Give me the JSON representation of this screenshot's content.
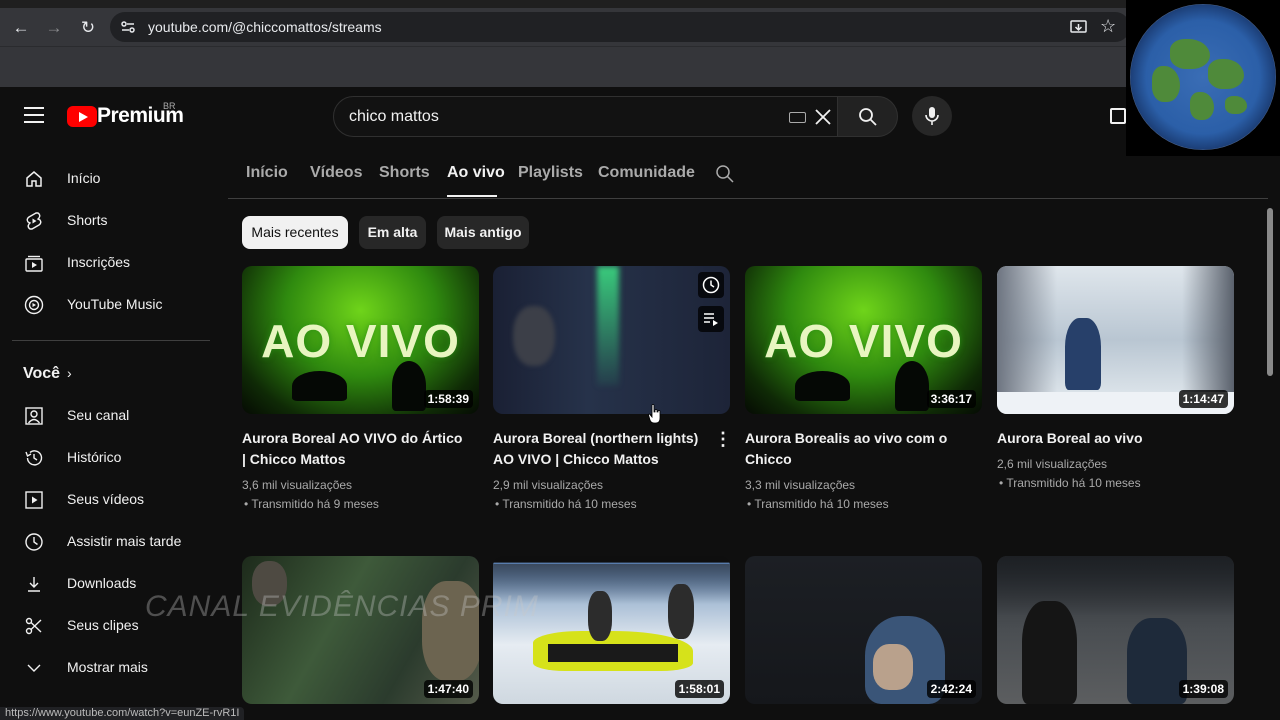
{
  "browser": {
    "url": "youtube.com/@chiccomattos/streams",
    "status_url": "https://www.youtube.com/watch?v=eunZE-rvR1I"
  },
  "masthead": {
    "logo_text": "Premium",
    "region": "BR",
    "search_value": "chico mattos"
  },
  "sidebar": {
    "main": [
      {
        "label": "Início",
        "icon": "home-icon"
      },
      {
        "label": "Shorts",
        "icon": "shorts-icon"
      },
      {
        "label": "Inscrições",
        "icon": "subscriptions-icon"
      },
      {
        "label": "YouTube Music",
        "icon": "youtube-music-icon"
      }
    ],
    "you_heading": "Você",
    "you": [
      {
        "label": "Seu canal",
        "icon": "channel-icon"
      },
      {
        "label": "Histórico",
        "icon": "history-icon"
      },
      {
        "label": "Seus vídeos",
        "icon": "your-videos-icon"
      },
      {
        "label": "Assistir mais tarde",
        "icon": "watch-later-icon"
      },
      {
        "label": "Downloads",
        "icon": "download-icon"
      },
      {
        "label": "Seus clipes",
        "icon": "clips-icon"
      },
      {
        "label": "Mostrar mais",
        "icon": "chevron-down-icon"
      }
    ]
  },
  "tabs": [
    "Início",
    "Vídeos",
    "Shorts",
    "Ao vivo",
    "Playlists",
    "Comunidade"
  ],
  "active_tab": "Ao vivo",
  "chips": [
    "Mais recentes",
    "Em alta",
    "Mais antigo"
  ],
  "videos": [
    {
      "title": "Aurora Boreal AO VIVO do Ártico | Chicco Mattos",
      "views": "3,6 mil visualizações",
      "age": "• Transmitido há 9 meses",
      "duration": "1:58:39",
      "thumb_text": "AO VIVO"
    },
    {
      "title": "Aurora Boreal (northern lights) AO VIVO | Chicco Mattos",
      "views": "2,9 mil visualizações",
      "age": "• Transmitido há 10 meses",
      "duration": "",
      "thumb_text": ""
    },
    {
      "title": "Aurora Borealis ao vivo com o Chicco",
      "views": "3,3 mil visualizações",
      "age": "• Transmitido há 10 meses",
      "duration": "3:36:17",
      "thumb_text": "AO VIVO"
    },
    {
      "title": "Aurora Boreal ao vivo",
      "views": "2,6 mil visualizações",
      "age": "• Transmitido há 10 meses",
      "duration": "1:14:47",
      "thumb_text": ""
    },
    {
      "duration": "1:47:40"
    },
    {
      "duration": "1:58:01"
    },
    {
      "duration": "2:42:24"
    },
    {
      "duration": "1:39:08"
    }
  ],
  "overlay": {
    "watermark": "CANAL EVIDÊNCIAS PRIM"
  }
}
